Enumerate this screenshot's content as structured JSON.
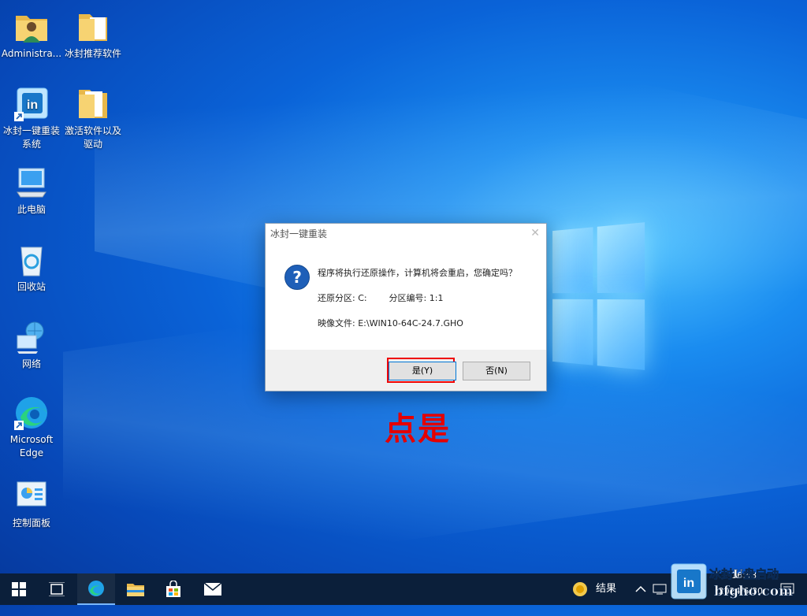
{
  "desktop": {
    "icons": [
      {
        "label": "Administra..."
      },
      {
        "label": "冰封推荐软件"
      },
      {
        "label": "冰封一键重装系统"
      },
      {
        "label": "激活软件以及驱动"
      },
      {
        "label": "此电脑"
      },
      {
        "label": "回收站"
      },
      {
        "label": "网络"
      },
      {
        "label": "Microsoft Edge"
      },
      {
        "label": "控制面板"
      }
    ]
  },
  "dialog": {
    "title": "冰封一键重装",
    "close_glyph": "✕",
    "question_glyph": "?",
    "message": "程序将执行还原操作，计算机将会重启，您确定吗？",
    "restore_partition": "还原分区: C:        分区编号: 1:1",
    "image_file": "映像文件: E:\\WIN10-64C-24.7.GHO",
    "yes_label": "是(Y)",
    "no_label": "否(N)"
  },
  "annotation": "点是",
  "taskbar": {
    "weather_text": "结果",
    "time": "16:48",
    "date": "2024/6/30"
  },
  "watermark": {
    "line1": "冰封U盘启动",
    "line2": "bfgho.com",
    "logo_text": "in"
  },
  "colors": {
    "accent": "#0078d7",
    "highlight": "#e00000",
    "annotation": "#e50000"
  }
}
